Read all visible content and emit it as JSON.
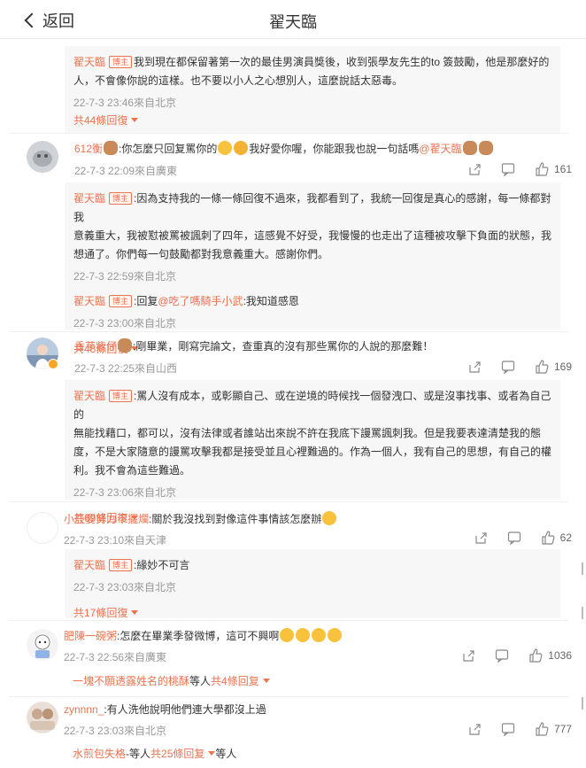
{
  "header": {
    "back_label": "返回",
    "title": "翟天臨"
  },
  "badge": "博主",
  "thread1": {
    "reply": {
      "name": "翟天臨",
      "text_l1": "我到現在都保留著第一次的最佳男演員獎後，收到張學友先生的to 簽鼓勵，他是那麼好的",
      "text_l2": "人，不會像你說的這樣。也不要以小人之心想別人，這麼說話太惡毒。",
      "time": "22-7-3 23:46來自北京"
    },
    "more": "共44條回復"
  },
  "comment1": {
    "name": "612衡",
    "text_a": ":你怎麼只回复罵你的",
    "text_b": "我好愛你喔，你能跟我也說一句話嗎",
    "mention": "@翟天臨",
    "time": "22-7-3 22:09來自廣東",
    "likes": "161",
    "replies": [
      {
        "name": "翟天臨",
        "l1": ":因為支持我的一條一條回復不過來，我都看到了，我統一回復是真心的感謝，每一條都對我",
        "l2": "意義重大，我被懟被罵被諷刺了四年，這感覺不好受，我慢慢的也走出了這種被攻擊下負面的狀態，我",
        "l3": "想通了。你們每一句鼓勵都對我意義重大。感謝你們。",
        "time": "22-7-3 22:59來自北京"
      },
      {
        "name": "翟天臨",
        "l1a": ":回复",
        "l1m": "@吃了嗎騎手小武",
        "l1b": ":我知道感恩",
        "time": "22-7-3 23:00來自北京"
      }
    ],
    "more": "共48條回復"
  },
  "comment2": {
    "name": "香芋紫仔",
    "text": ":剛畢業，剛寫完論文，查重真的沒有那些罵你的人說的那麼難！",
    "time": "22-7-3 22:25來自山西",
    "likes": "169",
    "reply": {
      "name": "翟天臨",
      "l1": ":罵人沒有成本，或彰顯自己、或在逆境的時候找一個發洩口、或是沒事找事、或者為自己的",
      "l2": "無能找藉口，都可以，沒有法律或者誰站出來說不許在我底下謾罵諷刺我。但是我要表達清楚我的態",
      "l3": "度，不是大家隨意的謾罵攻擊我都是接受並且心裡難過的。作為一個人，我有自己的思想，有自己的權",
      "l4": "利。我不會為這些難過。",
      "time": "22-7-3 23:06來自北京"
    },
    "more": "共69條回復"
  },
  "comment3": {
    "name": "小亞要努力不擺爛",
    "text": ":關於我沒找到對像這件事情該怎麼辦",
    "time": "22-7-3 23:10來自天津",
    "likes": "62",
    "reply": {
      "name": "翟天臨",
      "text": ":緣妙不可言",
      "time": "22-7-3 23:03來自北京"
    },
    "more": "共17條回復"
  },
  "comment4": {
    "name": "肥陳一碗粥",
    "text": ":怎麼在畢業季發微博，這可不興啊",
    "time": "22-7-3 22:56來自廣東",
    "likes": "1036",
    "sub_name": "一塊不願透露姓名的桃酥",
    "sub_mid": " 等人 ",
    "sub_more": "共4條回复"
  },
  "comment5": {
    "name": "zynnnn_",
    "text": ":有人洗他說明他們連大學都沒上過",
    "time": "22-7-3 23:03來自北京",
    "likes": "777",
    "sub_name": "水煎包失格",
    "sub_mid": "-等人 ",
    "sub_more": "共25條回复",
    "sub_tail": " 等人"
  },
  "colors": {
    "accent": "#eb7350",
    "reply_bg": "#f7f7f7",
    "meta": "#999999"
  }
}
